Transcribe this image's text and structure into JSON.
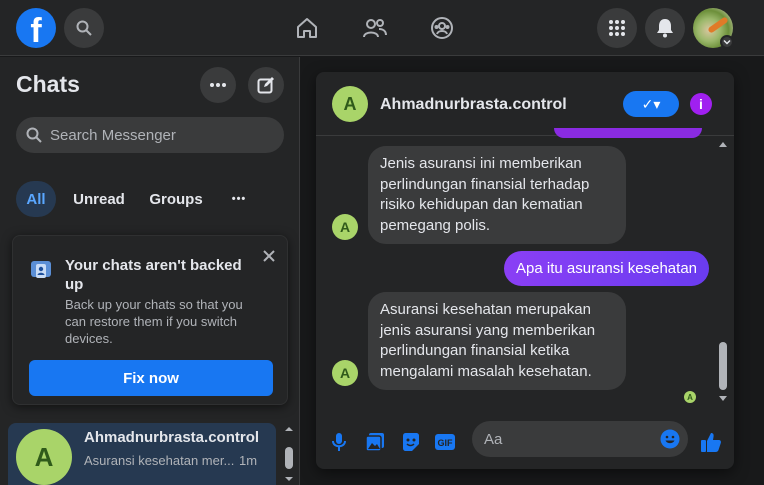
{
  "topbar": {
    "logo": "f",
    "icons": [
      "search-icon",
      "home-icon",
      "friends-icon",
      "groups-icon",
      "menu-grid-icon",
      "notifications-bell-icon",
      "profile-avatar"
    ]
  },
  "left": {
    "title": "Chats",
    "search_placeholder": "Search Messenger",
    "filters": [
      "All",
      "Unread",
      "Groups",
      "•••"
    ],
    "backup": {
      "title": "Your chats aren't backed up",
      "body": "Back up your chats so that you can restore them if you switch devices.",
      "button": "Fix now"
    },
    "conversation": {
      "avatar_letter": "A",
      "name": "Ahmadnurbrasta.control",
      "preview": "Asuransi kesehatan mer...",
      "time": "1m"
    }
  },
  "chat": {
    "avatar_letter": "A",
    "name": "Ahmadnurbrasta.control",
    "check_label": "✓▾",
    "info_label": "i",
    "messages": [
      {
        "from": "them",
        "text": "Jenis asuransi ini memberikan perlindungan finansial terhadap risiko kehidupan dan kematian pemegang polis."
      },
      {
        "from": "me",
        "text": "Apa itu asuransi kesehatan"
      },
      {
        "from": "them",
        "text": "Asuransi kesehatan merupakan jenis asuransi yang memberikan perlindungan finansial ketika mengalami masalah kesehatan."
      }
    ],
    "seen_letter": "A",
    "composer_placeholder": "Aa"
  },
  "colors": {
    "accent": "#1877f2",
    "outgoing_bubble": "#7b3ff5",
    "avatar_bg": "#a9d469",
    "selected_row": "#263951"
  }
}
